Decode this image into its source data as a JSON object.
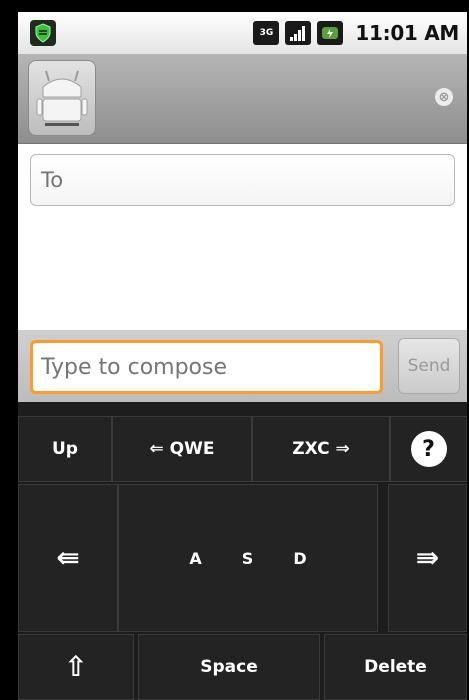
{
  "status_bar": {
    "network_label": "3G",
    "time": "11:01 AM"
  },
  "title_bar": {
    "clear_glyph": "⊗"
  },
  "recipient": {
    "placeholder": "To"
  },
  "compose": {
    "placeholder": "Type to compose",
    "send_label": "Send"
  },
  "keyboard": {
    "row1": {
      "up": "Up",
      "qwe": "⇐ QWE",
      "zxc": "ZXC ⇒",
      "help": "?"
    },
    "row2": {
      "left_arrow": "⇚",
      "letters": [
        "A",
        "S",
        "D"
      ],
      "right_arrow": "⇛"
    },
    "row3": {
      "shift": "⇧",
      "space": "Space",
      "delete": "Delete"
    }
  },
  "colors": {
    "compose_focus": "#ff9a2a",
    "keyboard_bg": "#1d1d1d"
  },
  "icons": {
    "status_left": "shield-icon",
    "signal": "signal-bars-icon",
    "battery": "battery-icon",
    "app": "android-icon",
    "clear": "clear-icon"
  }
}
